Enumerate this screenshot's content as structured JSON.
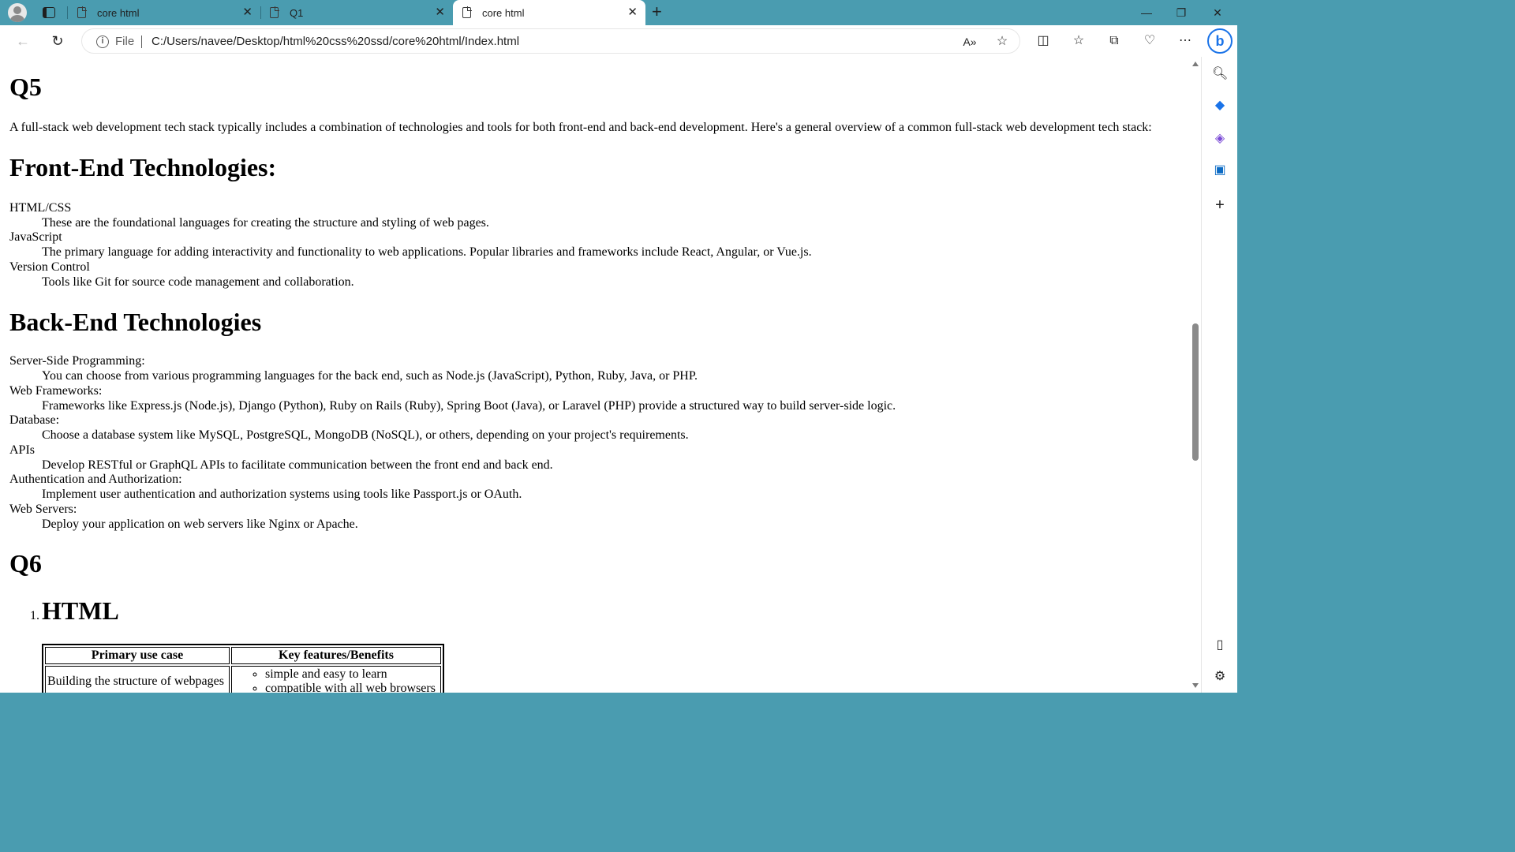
{
  "browser": {
    "tabs": [
      {
        "label": "core html",
        "state": "inactive"
      },
      {
        "label": "Q1",
        "state": "inactive"
      },
      {
        "label": "core html",
        "state": "active"
      }
    ],
    "address": {
      "scheme_label": "File",
      "url": "C:/Users/navee/Desktop/html%20css%20ssd/core%20html/Index.html"
    },
    "accent_color": "#4a9cb0"
  },
  "page": {
    "q5": {
      "heading": "Q5",
      "intro": "A full-stack web development tech stack typically includes a combination of technologies and tools for both front-end and back-end development. Here's a general overview of a common full-stack web development tech stack:"
    },
    "frontend": {
      "heading": "Front-End Technologies:",
      "items": [
        {
          "term": "HTML/CSS",
          "desc": "These are the foundational languages for creating the structure and styling of web pages."
        },
        {
          "term": "JavaScript",
          "desc": "The primary language for adding interactivity and functionality to web applications. Popular libraries and frameworks include React, Angular, or Vue.js."
        },
        {
          "term": "Version Control",
          "desc": "Tools like Git for source code management and collaboration."
        }
      ]
    },
    "backend": {
      "heading": "Back-End Technologies",
      "items": [
        {
          "term": "Server-Side Programming:",
          "desc": "You can choose from various programming languages for the back end, such as Node.js (JavaScript), Python, Ruby, Java, or PHP."
        },
        {
          "term": "Web Frameworks:",
          "desc": "Frameworks like Express.js (Node.js), Django (Python), Ruby on Rails (Ruby), Spring Boot (Java), or Laravel (PHP) provide a structured way to build server-side logic."
        },
        {
          "term": "Database:",
          "desc": "Choose a database system like MySQL, PostgreSQL, MongoDB (NoSQL), or others, depending on your project's requirements."
        },
        {
          "term": "APIs",
          "desc": "Develop RESTful or GraphQL APIs to facilitate communication between the front end and back end."
        },
        {
          "term": "Authentication and Authorization:",
          "desc": "Implement user authentication and authorization systems using tools like Passport.js or OAuth."
        },
        {
          "term": "Web Servers:",
          "desc": "Deploy your application on web servers like Nginx or Apache."
        }
      ]
    },
    "q6": {
      "heading": "Q6",
      "list_number": "1.",
      "list_heading": "HTML",
      "table": {
        "headers": [
          "Primary use case",
          "Key features/Benefits"
        ],
        "row1_use": "Building the structure of webpages",
        "row1_features": [
          "simple and easy to learn",
          "compatible with all web browsers"
        ]
      }
    }
  }
}
